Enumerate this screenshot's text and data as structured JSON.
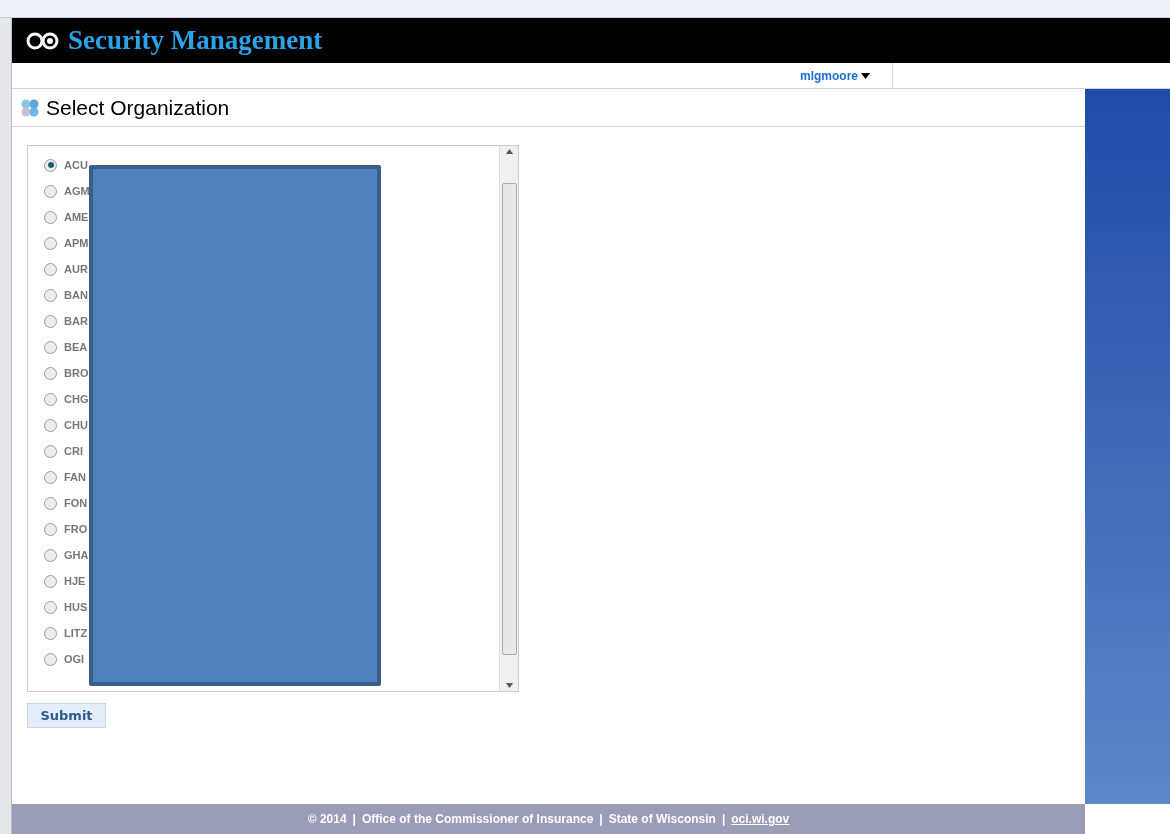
{
  "header": {
    "title": "Security Management"
  },
  "user_menu": {
    "label": "mlgmoore"
  },
  "page_title": "Select Organization",
  "organizations": [
    {
      "label": "ACU",
      "selected": true
    },
    {
      "label": "AGM",
      "selected": false
    },
    {
      "label": "AME",
      "selected": false
    },
    {
      "label": "APM",
      "selected": false
    },
    {
      "label": "AUR",
      "selected": false
    },
    {
      "label": "BAN",
      "selected": false
    },
    {
      "label": "BAR",
      "selected": false
    },
    {
      "label": "BEA",
      "selected": false
    },
    {
      "label": "BRO",
      "selected": false
    },
    {
      "label": "CHG",
      "selected": false
    },
    {
      "label": "CHU",
      "selected": false
    },
    {
      "label": "CRI",
      "selected": false
    },
    {
      "label": "FAN",
      "selected": false
    },
    {
      "label": "FON",
      "selected": false
    },
    {
      "label": "FRO",
      "selected": false
    },
    {
      "label": "GHA",
      "selected": false
    },
    {
      "label": "HJE",
      "selected": false
    },
    {
      "label": "HUS",
      "selected": false
    },
    {
      "label": "LITZ",
      "selected": false
    },
    {
      "label": "OGI",
      "selected": false
    }
  ],
  "submit_button": "Submit",
  "footer": [
    {
      "kind": "text",
      "text": "© 2014"
    },
    {
      "kind": "separator",
      "text": "|"
    },
    {
      "kind": "text",
      "text": "Office of the Commissioner of Insurance"
    },
    {
      "kind": "separator",
      "text": "|"
    },
    {
      "kind": "text",
      "text": "State of Wisconsin"
    },
    {
      "kind": "separator",
      "text": "|"
    },
    {
      "kind": "link",
      "text": "oci.wi.gov"
    }
  ]
}
